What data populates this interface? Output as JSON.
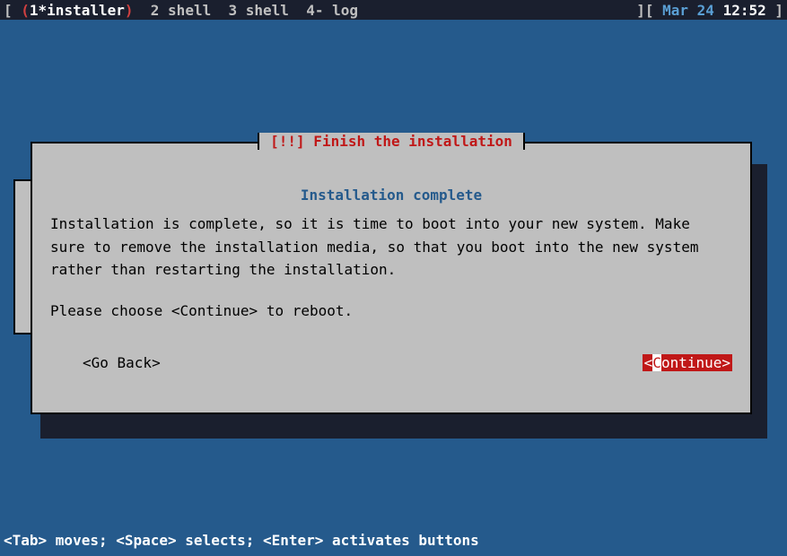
{
  "statusbar": {
    "lbracket": "[ ",
    "paren_open": "(",
    "tab1": "1*installer",
    "paren_close": ")",
    "tab2": "  2 shell",
    "tab3": "  3 shell",
    "tab4": "  4- log",
    "rbracket_close": "][ ",
    "date": "Mar 24",
    "time": " 12:52",
    "rbracket_end": " ]"
  },
  "dialog": {
    "title": "[!!] Finish the installation",
    "subtitle": "Installation complete",
    "body1": "Installation is complete, so it is time to boot into your new system. Make sure to remove the installation media, so that you boot into the new system rather than restarting the installation.",
    "body2": "Please choose <Continue> to reboot.",
    "go_back": "<Go Back>",
    "continue_pre": "<",
    "continue_hl": "C",
    "continue_post": "ontinue>"
  },
  "helpbar": {
    "text": "<Tab> moves; <Space> selects; <Enter> activates buttons"
  }
}
